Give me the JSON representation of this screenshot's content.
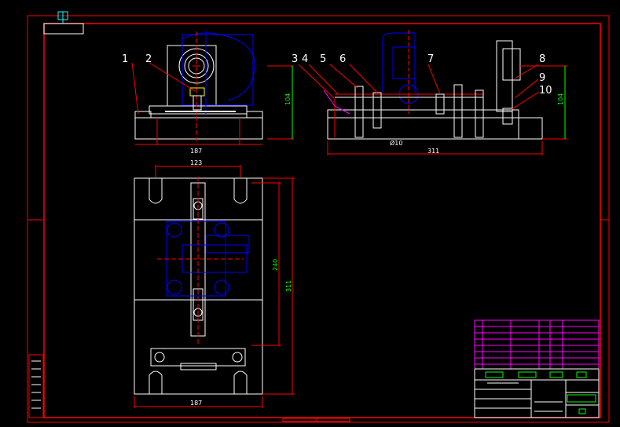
{
  "drawing": {
    "part_labels": [
      "1",
      "2",
      "3",
      "4",
      "5",
      "6",
      "7",
      "8",
      "9",
      "10"
    ],
    "dimensions": {
      "front_width": "187",
      "front_height": "104",
      "side_width": "311",
      "side_height": "104",
      "side_dia": "Ø10",
      "top_slot_span": "123",
      "plan_inner_height": "240",
      "plan_total_height": "311",
      "plan_width": "187"
    },
    "colors": {
      "frame": "#ff0000",
      "part": "#ffffff",
      "hidden": "#0000ff",
      "dimension": "#00ff00",
      "magenta": "#ff00ff",
      "cyan": "#00ffff"
    }
  }
}
